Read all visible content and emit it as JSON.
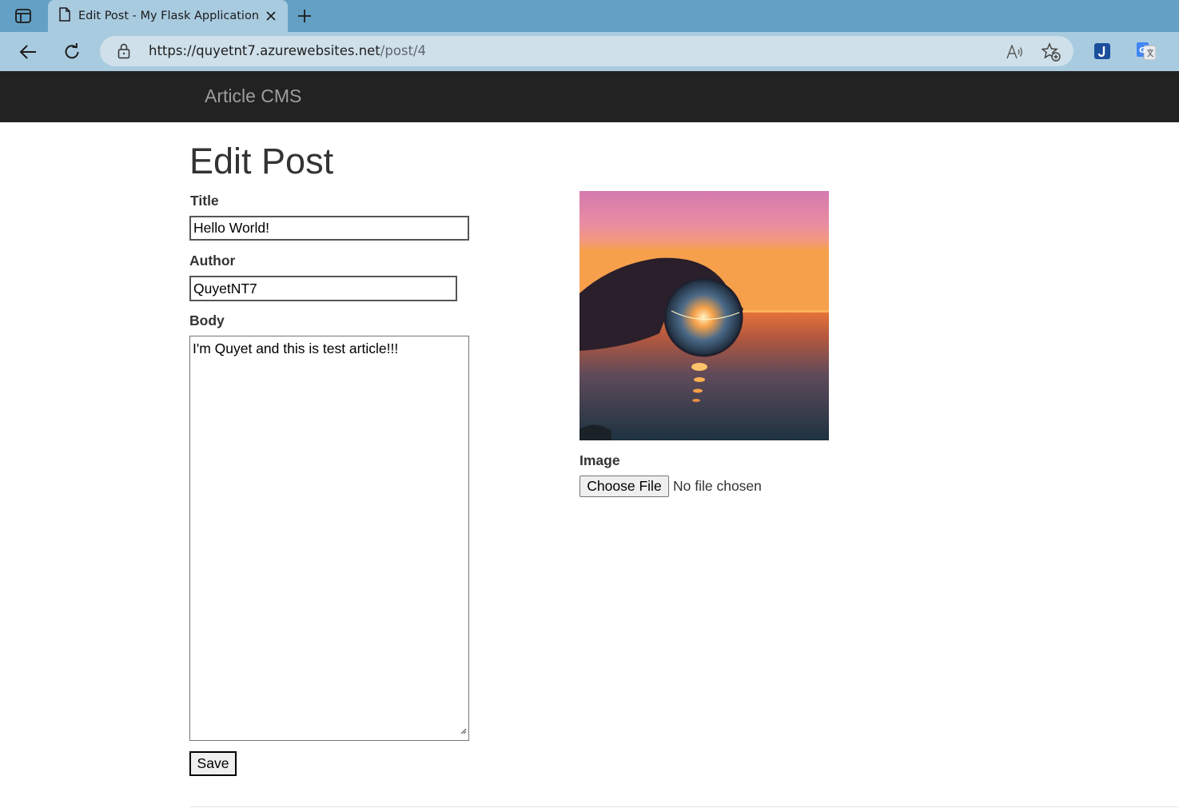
{
  "browser": {
    "tab_title": "Edit Post - My Flask Application",
    "url_host": "https://quyetnt7.azurewebsites.net",
    "url_path": "/post/4",
    "icons": [
      "tab-actions-icon",
      "page-icon",
      "close-icon",
      "plus-icon",
      "back-arrow-icon",
      "reload-icon",
      "lock-icon",
      "read-aloud-icon",
      "add-favorite-icon",
      "extension-j-icon",
      "translate-icon"
    ]
  },
  "navbar": {
    "brand": "Article CMS"
  },
  "page": {
    "title": "Edit Post"
  },
  "form": {
    "title_label": "Title",
    "title_value": "Hello World!",
    "author_label": "Author",
    "author_value": "QuyetNT7",
    "body_label": "Body",
    "body_value": "I'm Quyet and this is test article!!!",
    "save_label": "Save",
    "image_label": "Image",
    "choose_file_label": "Choose File",
    "no_file_text": "No file chosen"
  },
  "colors": {
    "tabbar": "#64a0c4",
    "toolbar": "#a9cbe0",
    "navbar": "#222222",
    "brand": "#9d9d9d"
  }
}
